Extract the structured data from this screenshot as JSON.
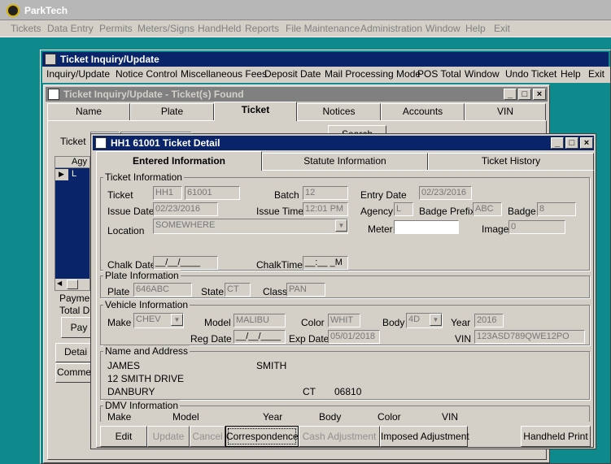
{
  "app": {
    "title": "ParkTech"
  },
  "main_menu": [
    "Tickets",
    "Data Entry",
    "Permits",
    "Meters/Signs",
    "HandHeld",
    "Reports",
    "File Maintenance",
    "Administration",
    "Window",
    "Help",
    "Exit"
  ],
  "inquiry_window": {
    "title": "Ticket Inquiry/Update",
    "menu": [
      "Inquiry/Update",
      "Notice Control",
      "Miscellaneous Fees",
      "Deposit Date",
      "Mail Processing Mode",
      "POS Total",
      "Window",
      "Undo Ticket",
      "Help",
      "Exit"
    ]
  },
  "found_window": {
    "title": "Ticket Inquiry/Update - Ticket(s) Found",
    "tabs": [
      "Name",
      "Plate",
      "Ticket",
      "Notices",
      "Accounts",
      "VIN"
    ],
    "ticket_label": "Ticket",
    "search_button": "Search",
    "grid_header": "Agy",
    "grid_row": "L",
    "payment_label": "Paymer",
    "total_due_label": "Total Du",
    "pay_button": "Pay",
    "detail_button": "Detai",
    "comment_button": "Commer"
  },
  "detail_window": {
    "title": "HH1 61001 Ticket Detail",
    "tabs": [
      "Entered Information",
      "Statute Information",
      "Ticket History"
    ],
    "ticket_info": {
      "group_title": "Ticket Information",
      "ticket_label": "Ticket",
      "ticket_prefix": "HH1",
      "ticket_number": "61001",
      "batch_label": "Batch",
      "batch": "12",
      "entry_date_label": "Entry Date",
      "entry_date": "02/23/2016",
      "issue_date_label": "Issue Date",
      "issue_date": "02/23/2016",
      "issue_time_label": "Issue Time",
      "issue_time": "12:01 PM",
      "agency_label": "Agency",
      "agency": "L",
      "badge_prefix_label": "Badge Prefix",
      "badge_prefix": "ABC",
      "badge_label": "Badge",
      "badge": "8",
      "location_label": "Location",
      "location": "SOMEWHERE",
      "meter_label": "Meter",
      "meter": "",
      "image_label": "Image",
      "image": "0",
      "chalk_date_label": "Chalk Date",
      "chalk_date": "__/__/____",
      "chalk_time_label": "ChalkTime",
      "chalk_time": "__:__ _M"
    },
    "plate_info": {
      "group_title": "Plate Information",
      "plate_label": "Plate",
      "plate": "646ABC",
      "state_label": "State",
      "state": "CT",
      "class_label": "Class",
      "class": "PAN"
    },
    "vehicle_info": {
      "group_title": "Vehicle Information",
      "make_label": "Make",
      "make": "CHEV",
      "model_label": "Model",
      "model": "MALIBU",
      "color_label": "Color",
      "color": "WHIT",
      "body_label": "Body",
      "body": "4D",
      "year_label": "Year",
      "year": "2016",
      "reg_date_label": "Reg Date",
      "reg_date": "__/__/____",
      "exp_date_label": "Exp Date",
      "exp_date": "05/01/2018",
      "vin_label": "VIN",
      "vin": "123ASD789QWE12PO"
    },
    "name_address": {
      "group_title": "Name and Address",
      "first_name": "JAMES",
      "last_name": "SMITH",
      "street": "12 SMITH DRIVE",
      "city": "DANBURY",
      "state": "CT",
      "zip": "06810"
    },
    "dmv_info": {
      "group_title": "DMV Information",
      "columns": [
        "Make",
        "Model",
        "Year",
        "Body",
        "Color",
        "VIN"
      ]
    },
    "buttons": {
      "edit": "Edit",
      "update": "Update",
      "cancel": "Cancel",
      "correspondence": "Correspondence",
      "cash_adjustment": "Cash Adjustment",
      "imposed_adjustment": "Imposed Adjustment",
      "handheld_print": "Handheld Print"
    }
  }
}
